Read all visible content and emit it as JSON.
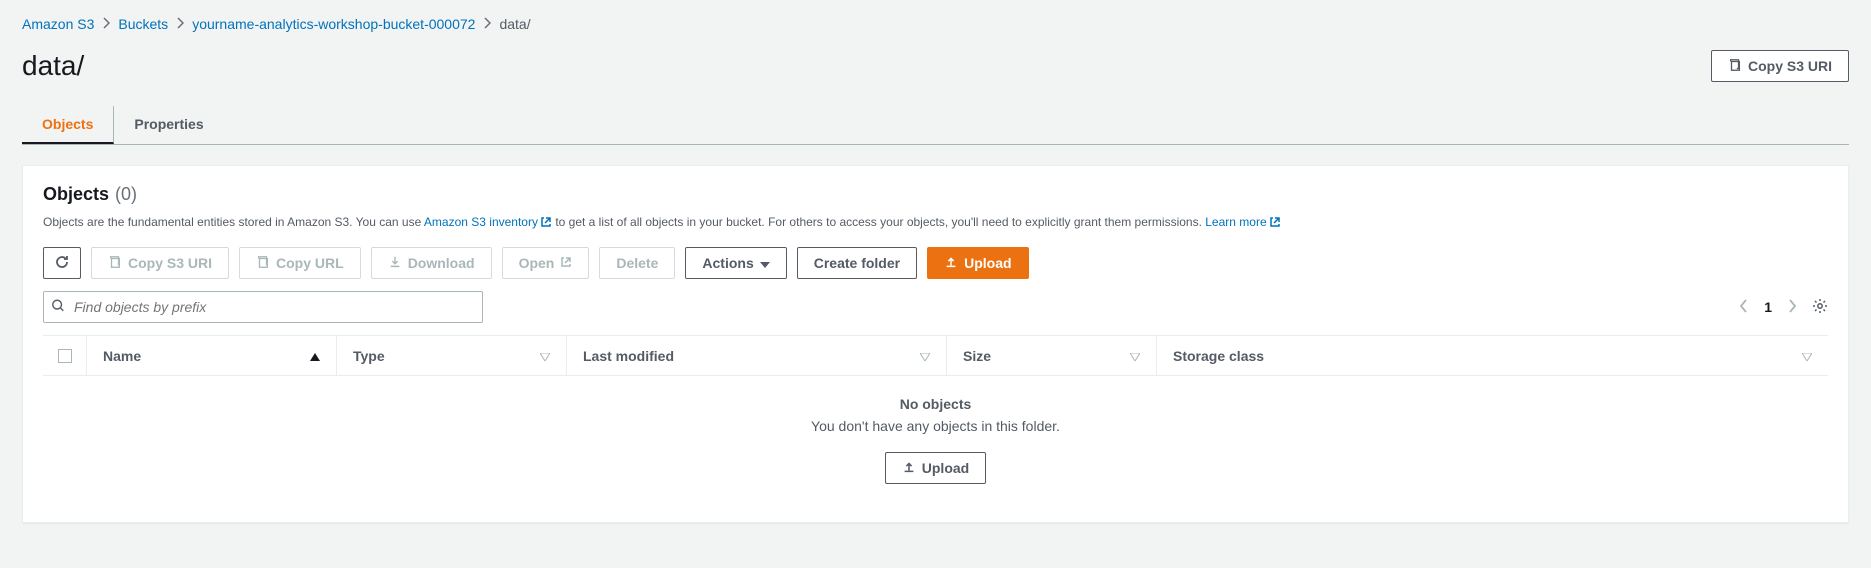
{
  "breadcrumb": {
    "items": [
      {
        "label": "Amazon S3"
      },
      {
        "label": "Buckets"
      },
      {
        "label": "yourname-analytics-workshop-bucket-000072"
      }
    ],
    "current": "data/"
  },
  "header": {
    "title": "data/",
    "copy_uri_label": "Copy S3 URI"
  },
  "tabs": {
    "objects": "Objects",
    "properties": "Properties"
  },
  "panel": {
    "title": "Objects",
    "count": "(0)",
    "desc_prefix": "Objects are the fundamental entities stored in Amazon S3. You can use ",
    "desc_link1": "Amazon S3 inventory",
    "desc_mid": " to get a list of all objects in your bucket. For others to access your objects, you'll need to explicitly grant them permissions. ",
    "desc_link2": "Learn more"
  },
  "toolbar": {
    "copy_uri": "Copy S3 URI",
    "copy_url": "Copy URL",
    "download": "Download",
    "open": "Open",
    "delete": "Delete",
    "actions": "Actions",
    "create_folder": "Create folder",
    "upload": "Upload"
  },
  "search": {
    "placeholder": "Find objects by prefix"
  },
  "pagination": {
    "page": "1"
  },
  "columns": {
    "name": "Name",
    "type": "Type",
    "modified": "Last modified",
    "size": "Size",
    "storage": "Storage class"
  },
  "empty": {
    "title": "No objects",
    "desc": "You don't have any objects in this folder.",
    "upload": "Upload"
  }
}
